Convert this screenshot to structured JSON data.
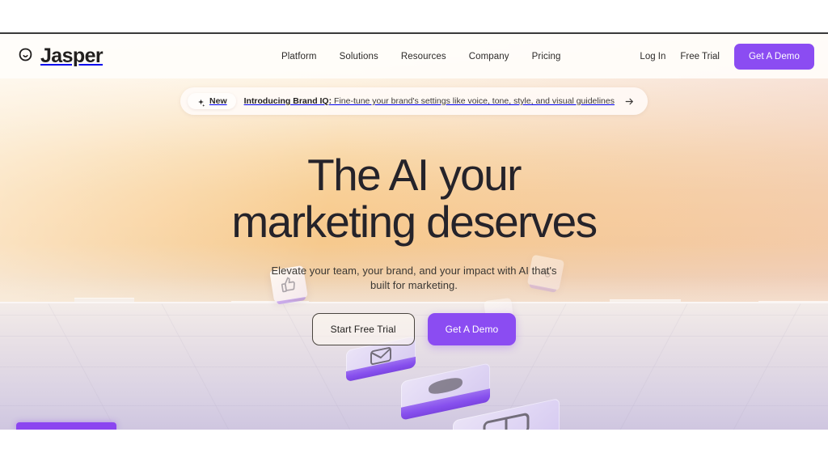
{
  "brand": {
    "name": "Jasper",
    "logo_icon": "jasper-smiley-icon",
    "accent_purple": "#8b4cf2",
    "text_dark": "#25232a"
  },
  "header": {
    "nav": [
      {
        "label": "Platform"
      },
      {
        "label": "Solutions"
      },
      {
        "label": "Resources"
      },
      {
        "label": "Company"
      },
      {
        "label": "Pricing"
      }
    ],
    "login_label": "Log In",
    "free_trial_label": "Free Trial",
    "demo_button_label": "Get A Demo"
  },
  "announcement": {
    "badge_label": "New",
    "badge_icon": "sparkle-icon",
    "title": "Introducing Brand IQ:",
    "message": "Fine-tune your brand's settings like voice, tone, style, and visual guidelines",
    "arrow_icon": "arrow-right-icon"
  },
  "hero": {
    "headline_line1": "The AI your",
    "headline_line2": "marketing deserves",
    "subheadline": "Elevate your team, your brand, and your impact with AI that's built for marketing.",
    "primary_cta": "Start Free Trial",
    "secondary_cta": "Get A Demo"
  },
  "decorations": {
    "tiles": [
      {
        "icon": "envelope-icon"
      },
      {
        "icon": "badge-icon"
      },
      {
        "icon": "layout-icon"
      }
    ],
    "cards": [
      {
        "icon": "thumbs-up-icon"
      },
      {
        "icon": "blank-card-icon"
      }
    ]
  }
}
